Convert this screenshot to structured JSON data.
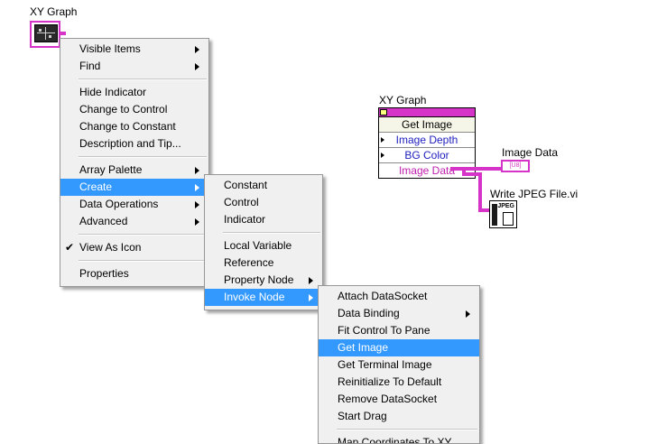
{
  "terminal": {
    "label": "XY Graph"
  },
  "menu1": {
    "items": [
      {
        "label": "Visible Items",
        "submenu": true
      },
      {
        "label": "Find",
        "submenu": true
      },
      {
        "sep": true
      },
      {
        "label": "Hide Indicator"
      },
      {
        "label": "Change to Control"
      },
      {
        "label": "Change to Constant"
      },
      {
        "label": "Description and Tip..."
      },
      {
        "sep": true
      },
      {
        "label": "Array Palette",
        "submenu": true
      },
      {
        "label": "Create",
        "submenu": true,
        "selected": true
      },
      {
        "label": "Data Operations",
        "submenu": true
      },
      {
        "label": "Advanced",
        "submenu": true
      },
      {
        "sep": true
      },
      {
        "label": "View As Icon",
        "checked": true
      },
      {
        "sep": true
      },
      {
        "label": "Properties"
      }
    ]
  },
  "menu2": {
    "items": [
      {
        "label": "Constant"
      },
      {
        "label": "Control"
      },
      {
        "label": "Indicator"
      },
      {
        "sep": true
      },
      {
        "label": "Local Variable"
      },
      {
        "label": "Reference"
      },
      {
        "label": "Property Node",
        "submenu": true
      },
      {
        "label": "Invoke Node",
        "submenu": true,
        "selected": true
      }
    ]
  },
  "menu3": {
    "items": [
      {
        "label": "Attach DataSocket"
      },
      {
        "label": "Data Binding",
        "submenu": true
      },
      {
        "label": "Fit Control To Pane"
      },
      {
        "label": "Get Image",
        "selected": true
      },
      {
        "label": "Get Terminal Image"
      },
      {
        "label": "Reinitialize To Default"
      },
      {
        "label": "Remove DataSocket"
      },
      {
        "label": "Start Drag"
      },
      {
        "sep": true
      },
      {
        "label": "Map Coordinates To XY"
      }
    ]
  },
  "diagram": {
    "node_label": "XY Graph",
    "method": "Get Image",
    "param_depth": "Image Depth",
    "param_bg": "BG Color",
    "output": "Image Data",
    "indicator_label": "Image Data",
    "indicator_glyph": "[U8]",
    "vi_label": "Write JPEG File.vi",
    "vi_glyph": "JPEG"
  },
  "colors": {
    "selection": "#3399ff",
    "refnum_wire": "#d633c8",
    "menu_bg": "#f0f0f0"
  }
}
